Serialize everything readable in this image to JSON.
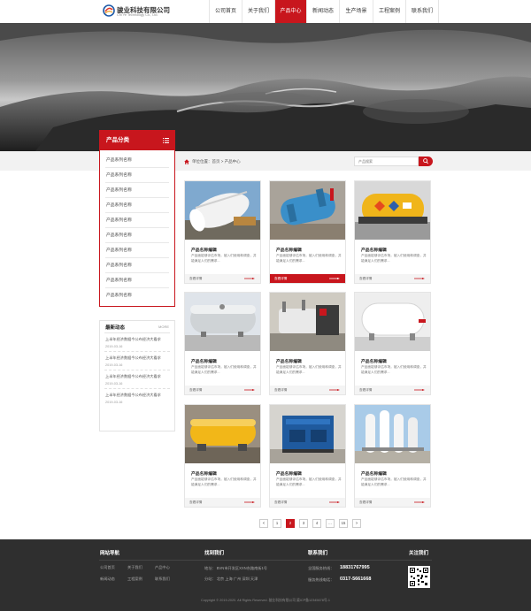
{
  "header": {
    "company_name": "骏业科技有限公司",
    "company_name_en": "Chi Ye Technology Co., Ltd.",
    "nav": [
      "公司首页",
      "关于我们",
      "产品中心",
      "新闻动态",
      "生产场景",
      "工程案例",
      "联系我们"
    ],
    "active_nav": "产品中心"
  },
  "sidebar": {
    "category_title": "产品分类",
    "categories": [
      "产品系列名称",
      "产品系列名称",
      "产品系列名称",
      "产品系列名称",
      "产品系列名称",
      "产品系列名称",
      "产品系列名称",
      "产品系列名称",
      "产品系列名称",
      "产品系列名称"
    ],
    "news_title": "最新动态",
    "news_more": "MORE",
    "news": [
      {
        "text": "上半年经济数据今公布经济大看求",
        "date": "2019-03-16"
      },
      {
        "text": "上半年经济数据今公布经济大看求",
        "date": "2019-03-16"
      },
      {
        "text": "上半年经济数据今公布经济大看求",
        "date": "2019-03-16"
      },
      {
        "text": "上半年经济数据今公布经济大看求",
        "date": "2019-03-16"
      }
    ]
  },
  "breadcrumb": "单位位置：首页 > 产品中心",
  "search": {
    "placeholder": "产品搜索"
  },
  "products": [
    {
      "name": "产品名称编辑",
      "desc": "产品面能够评估市场，被入们使用和调查，并能满足人们的需求...",
      "more": "查看详情"
    },
    {
      "name": "产品名称编辑",
      "desc": "产品面能够评估市场，被入们使用和调查，并能满足人们的需求...",
      "more": "查看详情"
    },
    {
      "name": "产品名称编辑",
      "desc": "产品面能够评估市场，被入们使用和调查，并能满足人们的需求...",
      "more": "查看详情"
    },
    {
      "name": "产品名称编辑",
      "desc": "产品面能够评估市场，被入们使用和调查，并能满足人们的需求...",
      "more": "查看详情"
    },
    {
      "name": "产品名称编辑",
      "desc": "产品面能够评估市场，被入们使用和调查，并能满足人们的需求...",
      "more": "查看详情"
    },
    {
      "name": "产品名称编辑",
      "desc": "产品面能够评估市场，被入们使用和调查，并能满足人们的需求...",
      "more": "查看详情"
    },
    {
      "name": "产品名称编辑",
      "desc": "产品面能够评估市场，被入们使用和调查，并能满足人们的需求...",
      "more": "查看详情"
    },
    {
      "name": "产品名称编辑",
      "desc": "产品面能够评估市场，被入们使用和调查，并能满足人们的需求...",
      "more": "查看详情"
    },
    {
      "name": "产品名称编辑",
      "desc": "产品面能够评估市场，被入们使用和调查，并能满足人们的需求...",
      "more": "查看详情"
    }
  ],
  "pagination": [
    "<",
    "1",
    "2",
    "3",
    "4",
    "...",
    "15",
    ">"
  ],
  "active_page": "2",
  "footer": {
    "nav_title": "网站导航",
    "nav_links": [
      "公司首页",
      "关于我们",
      "产品中心",
      "新闻动态",
      "工程案例",
      "联系我们"
    ],
    "find_title": "找到我们",
    "address": "地址：  BVN市开发区XXN东路南街1号",
    "branches": "分站：  北京    上海    广州    深圳    天津",
    "contact_title": "联系我们",
    "phone_label": "全国服务热线：",
    "phone": "18831767995",
    "tel_label": "服务热线电话：",
    "tel": "0317-5661668",
    "follow_title": "关注我们",
    "copyright": "Copyright © 2019-2020. All Rights Reserved.   骏业科技有限公司   冀ICP备12345678号-1"
  },
  "colors": {
    "accent": "#c8161d",
    "footer_bg": "#2f2f2f",
    "subbar_bg": "#f2f2f2"
  }
}
